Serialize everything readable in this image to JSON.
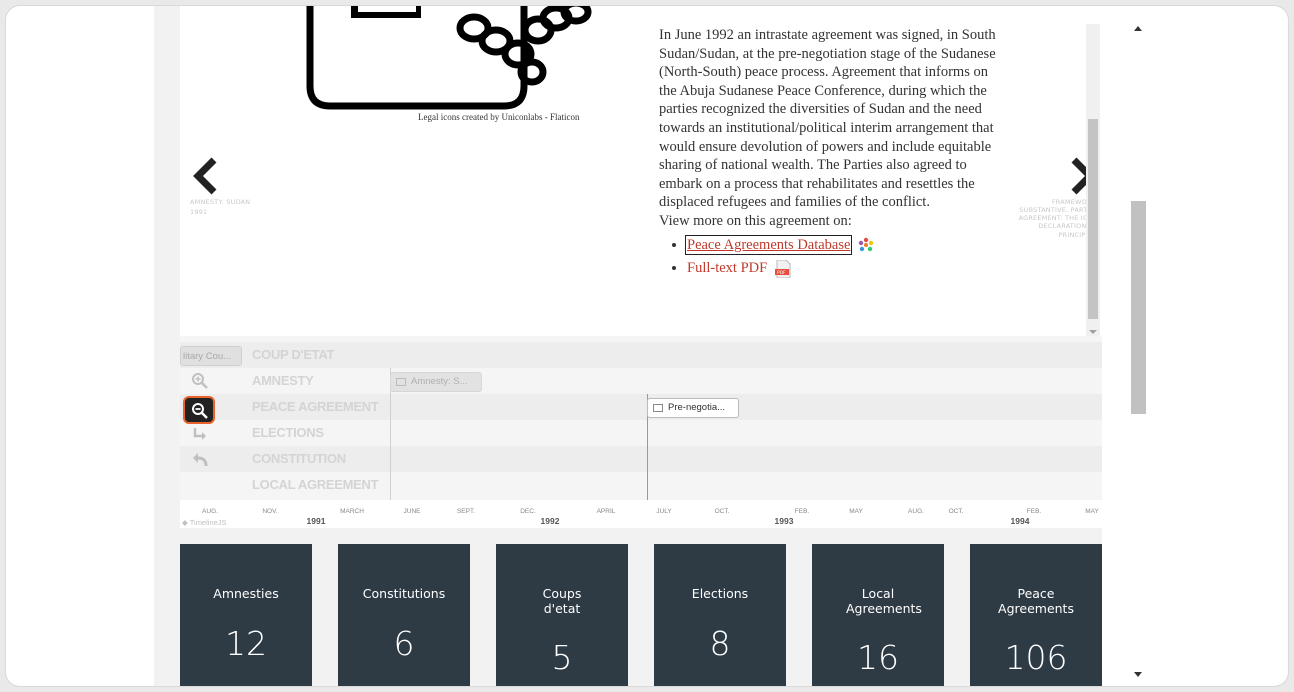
{
  "slide": {
    "credit": "Legal icons created by Uniconlabs - Flaticon",
    "description": "In June 1992 an intrastate agreement was signed, in South Sudan/Sudan, at the pre-negotiation stage of the Sudanese (North-South) peace process. Agreement that informs on the Abuja Sudanese Peace Conference, during which the parties recognized the diversities of Sudan and the need towards an institutional/political interim arrangement that would ensure devolution of powers and include equitable sharing of national wealth. The Parties also agreed to embark on a process that rehabilitates and resettles the displaced refugees and families of the conflict.",
    "view_more": "View more on this agreement on:",
    "link_pa_database": "Peace Agreements Database",
    "link_full_text": "Full-text PDF",
    "prev_title": "AMNESTY: SUDAN",
    "prev_date": "1991",
    "next_title": "FRAMEWORK-SUBSTANTIVE, PARTIAL AGREEMENT: THE IGAD DECLARATION OF PRINCIPLES"
  },
  "timeline": {
    "groups": [
      "COUP D'ETAT",
      "AMNESTY",
      "PEACE AGREEMENT",
      "ELECTIONS",
      "CONSTITUTION",
      "LOCAL AGREEMENT"
    ],
    "pill": "litary Cou...",
    "marker_amnesty": "Amnesty: S...",
    "marker_pre": "Pre-negotia...",
    "ticks": [
      "AUG.",
      "NOV.",
      "MARCH",
      "JUNE",
      "SEPT.",
      "DEC.",
      "APRIL",
      "JULY",
      "OCT.",
      "FEB.",
      "MAY",
      "AUG.",
      "OCT.",
      "FEB.",
      "MAY"
    ],
    "years": [
      "1991",
      "1992",
      "1993",
      "1994"
    ],
    "brand": "TimelineJS"
  },
  "cards": [
    {
      "label": "Amnesties",
      "count": "12"
    },
    {
      "label": "Constitutions",
      "count": "6"
    },
    {
      "label": "Coups d'etat",
      "count": "5"
    },
    {
      "label": "Elections",
      "count": "8"
    },
    {
      "label": "Local Agreements",
      "count": "16"
    },
    {
      "label": "Peace Agreements",
      "count": "106"
    }
  ],
  "colors": {
    "card_bg": "#2e3a44",
    "link": "#c0392b",
    "highlight": "#e8632b"
  }
}
